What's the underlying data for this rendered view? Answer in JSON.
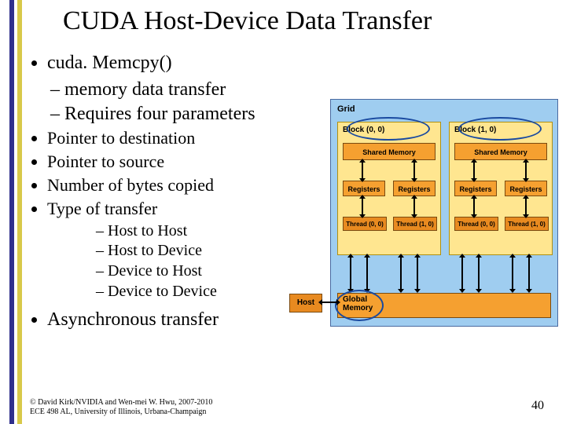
{
  "title": "CUDA Host-Device Data Transfer",
  "bullets": {
    "l1": "cuda. Memcpy()",
    "l2a": "– memory data transfer",
    "l2b": "– Requires four parameters",
    "l3a": "Pointer to destination",
    "l3b": "Pointer to source",
    "l3c": "Number of bytes copied",
    "l3d": "Type of transfer",
    "l4a": "– Host to Host",
    "l4b": "– Host to Device",
    "l4c": "– Device to Host",
    "l4d": "– Device to Device",
    "l5": "Asynchronous transfer"
  },
  "diagram": {
    "grid": "Grid",
    "block0": "Block (0, 0)",
    "block1": "Block (1, 0)",
    "shared": "Shared Memory",
    "registers": "Registers",
    "thread00": "Thread (0, 0)",
    "thread10": "Thread (1, 0)",
    "global": "Global\nMemory",
    "host": "Host"
  },
  "footer": {
    "copyright": "© David Kirk/NVIDIA and Wen-mei W. Hwu, 2007-2010\nECE 498 AL, University of Illinois, Urbana-Champaign",
    "page": "40"
  }
}
